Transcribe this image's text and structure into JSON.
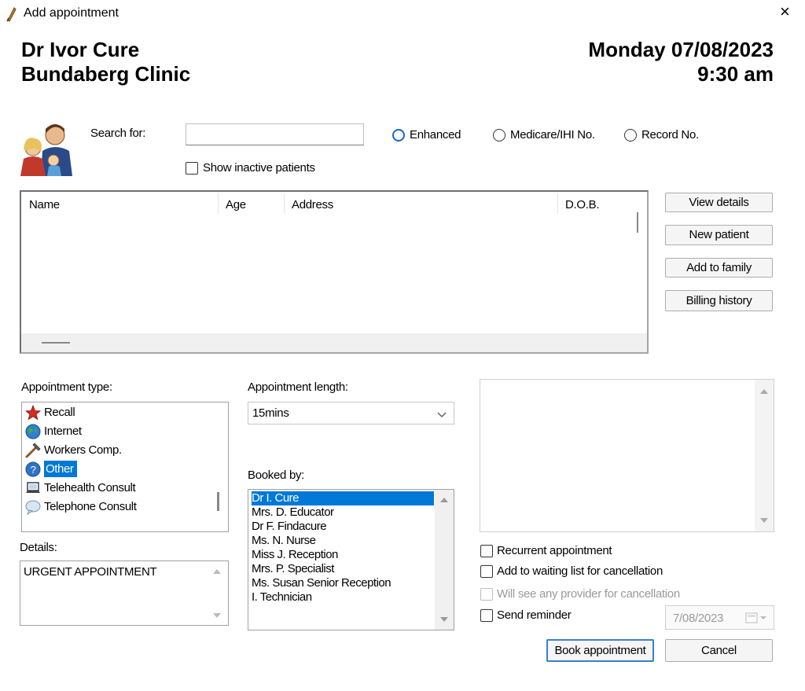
{
  "window": {
    "title": "Add appointment",
    "close_glyph": "×"
  },
  "header": {
    "doctor": "Dr Ivor Cure",
    "clinic": "Bundaberg Clinic",
    "date": "Monday 07/08/2023",
    "time": "9:30 am"
  },
  "search": {
    "label": "Search for:",
    "value": "",
    "modes": [
      {
        "label": "Enhanced",
        "selected": true
      },
      {
        "label": "Medicare/IHI No.",
        "selected": false
      },
      {
        "label": "Record No.",
        "selected": false
      }
    ],
    "show_inactive_label": "Show inactive patients",
    "show_inactive_checked": false
  },
  "patients_table": {
    "columns": [
      "Name",
      "Age",
      "Address",
      "D.O.B."
    ],
    "rows": []
  },
  "side_buttons": {
    "view_details": "View details",
    "new_patient": "New patient",
    "add_to_family": "Add to family",
    "billing_history": "Billing history"
  },
  "appointment_type": {
    "label": "Appointment type:",
    "items": [
      {
        "label": "Recall",
        "icon": "star-icon"
      },
      {
        "label": "Internet",
        "icon": "globe-icon"
      },
      {
        "label": "Workers Comp.",
        "icon": "hammer-icon"
      },
      {
        "label": "Other",
        "icon": "question-icon"
      },
      {
        "label": "Telehealth Consult",
        "icon": "laptop-icon"
      },
      {
        "label": "Telephone Consult",
        "icon": "speech-bubble-icon"
      }
    ],
    "selected": "Other"
  },
  "appointment_length": {
    "label": "Appointment length:",
    "value": "15mins"
  },
  "booked_by": {
    "label": "Booked by:",
    "items": [
      "Dr I. Cure",
      "Mrs. D. Educator",
      "Dr F. Findacure",
      "Ms. N. Nurse",
      "Miss J. Reception",
      "Mrs. P. Specialist",
      "Ms. Susan Senior Reception",
      "I. Technician"
    ],
    "selected": "Dr I. Cure"
  },
  "details": {
    "label": "Details:",
    "value": "URGENT APPOINTMENT"
  },
  "notes": {
    "value": ""
  },
  "options": {
    "recurrent": {
      "label": "Recurrent appointment",
      "checked": false
    },
    "waiting_list": {
      "label": "Add to waiting list for cancellation",
      "checked": false
    },
    "any_provider": {
      "label": "Will see any provider for cancellation",
      "checked": false,
      "disabled": true
    },
    "send_reminder": {
      "label": "Send reminder",
      "checked": false
    },
    "reminder_date": "7/08/2023"
  },
  "actions": {
    "book": "Book appointment",
    "cancel": "Cancel"
  },
  "colors": {
    "selection": "#0078d7",
    "radio_accent": "#1a67c4",
    "default_button_border": "#3a7fd1"
  }
}
